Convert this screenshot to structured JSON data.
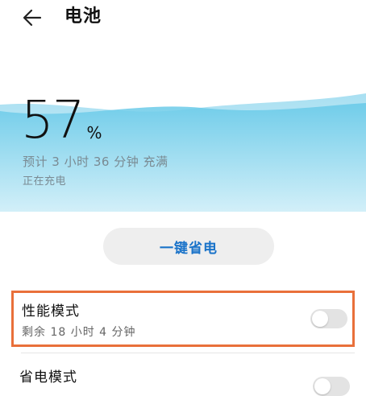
{
  "header": {
    "title": "电池",
    "back_icon": "arrow-left-icon"
  },
  "battery": {
    "percent": "57",
    "unit": "%",
    "estimate": "预计 3 小时 36 分钟 充满",
    "status": "正在充电",
    "wave_color": "#5fc7e6"
  },
  "actions": {
    "one_key_save": "一键省电",
    "accent_color": "#1a73c9"
  },
  "settings": [
    {
      "title": "性能模式",
      "subtitle": "剩余 18 小时 4 分钟",
      "enabled": false,
      "highlighted": true,
      "highlight_color": "#e9703a"
    },
    {
      "title": "省电模式",
      "enabled": false
    }
  ]
}
